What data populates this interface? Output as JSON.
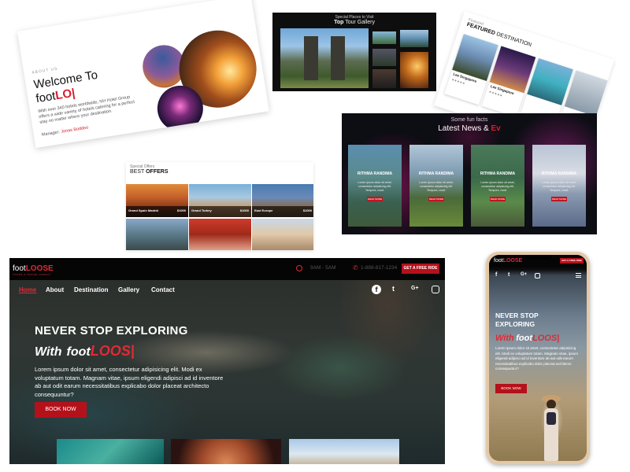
{
  "about": {
    "label": "ABOUT US",
    "title_line1": "Welcome To",
    "title_brand_plain": "foot",
    "title_brand_red": "LO|",
    "paragraph": "With over 340 hotels worldwide, NH Hotel Group offers a wide variety of hotels catering for a perfect stay no matter where your destination.",
    "manager_label": "Manager",
    "manager_name": "Jonas Boddeo"
  },
  "gallery": {
    "subtitle": "Special Places to Visit",
    "title_plain": "Top",
    "title_rest": "Tour Gallery"
  },
  "featured": {
    "subtitle": "Featured",
    "title_plain": "FEATURED",
    "title_rest": "DESTINATION",
    "cards": [
      {
        "name": "Lee Singapore",
        "sub": "★★★★★"
      },
      {
        "name": "Lee Singapore",
        "sub": "★★★★★"
      },
      {
        "name": "",
        "sub": ""
      },
      {
        "name": "",
        "sub": ""
      }
    ]
  },
  "news": {
    "subtitle": "Some fun facts",
    "title_plain": "Latest News &",
    "title_red": "Ev",
    "cards": [
      {
        "title": "RITHMA RANDIMA",
        "desc": "Lorem ipsum dolor sit amet, consectetur adipisicing elit. Tempore, modi.",
        "button": "READ MORE"
      },
      {
        "title": "RITHMA RANDIMA",
        "desc": "Lorem ipsum dolor sit amet, consectetur adipisicing elit. Tempore, modi.",
        "button": "READ MORE"
      },
      {
        "title": "RITHMA RANDIMA",
        "desc": "Lorem ipsum dolor sit amet, consectetur adipisicing elit. Tempore, modi.",
        "button": "READ MORE"
      },
      {
        "title": "RITHMA RANDIMA",
        "desc": "Lorem ipsum dolor sit amet, consectetur adipisicing elit. Tempore, modi.",
        "button": "READ MORE"
      }
    ]
  },
  "offers": {
    "subtitle": "Special Offers",
    "title_plain": "BEST",
    "title_rest": "OFFERS",
    "items": [
      {
        "name": "Grand Spain Madrid",
        "price": "$1000"
      },
      {
        "name": "Grand Turkey",
        "price": "$1000"
      },
      {
        "name": "East Europe",
        "price": "$1000"
      }
    ]
  },
  "hero": {
    "logo_plain": "foot",
    "logo_red": "LOOSE",
    "logo_tag": "TOURS & TRAVEL AGENCY",
    "hours": "9AM - 5AM",
    "phone": "1-888-817-1234",
    "cta_top": "GET A FREE RIDE",
    "nav": [
      "Home",
      "About",
      "Destination",
      "Gallery",
      "Contact"
    ],
    "social": [
      "f",
      "t",
      "G+",
      "ig"
    ],
    "headline": "NEVER STOP EXPLORING",
    "with": "With",
    "brand_plain": "foot",
    "brand_red": "LOOS|",
    "description": "Lorem ipsum dolor sit amet, consectetur adipisicing elit. Modi ex voluptatum totam. Magnam vitae, ipsum eligendi adipisci ad id inventore ab aut odit earum necessitatibus explicabo dolor placeat architecto consequuntur?",
    "book_button": "BOOK NOW"
  },
  "phone": {
    "logo_plain": "foot",
    "logo_red": "LOOSE",
    "cta_top": "GET A FREE RIDE",
    "headline_1": "NEVER STOP",
    "headline_2": "EXPLORING",
    "with": "With",
    "brand_plain": "foot",
    "brand_red": "LOOS|",
    "description": "Lorem ipsum dolor sit amet, consectetur adipisicing elit. Modi ex voluptatum totam. Magnam vitae, ipsum eligendi adipisci ad id inventore ab aut odit earum necessitatibus explicabo dolor placeat architecto consequuntur?",
    "book_button": "BOOK NOW",
    "social": [
      "f",
      "t",
      "G+",
      "ig"
    ]
  },
  "colors": {
    "accent": "#d61f2b",
    "dark": "#050505"
  }
}
